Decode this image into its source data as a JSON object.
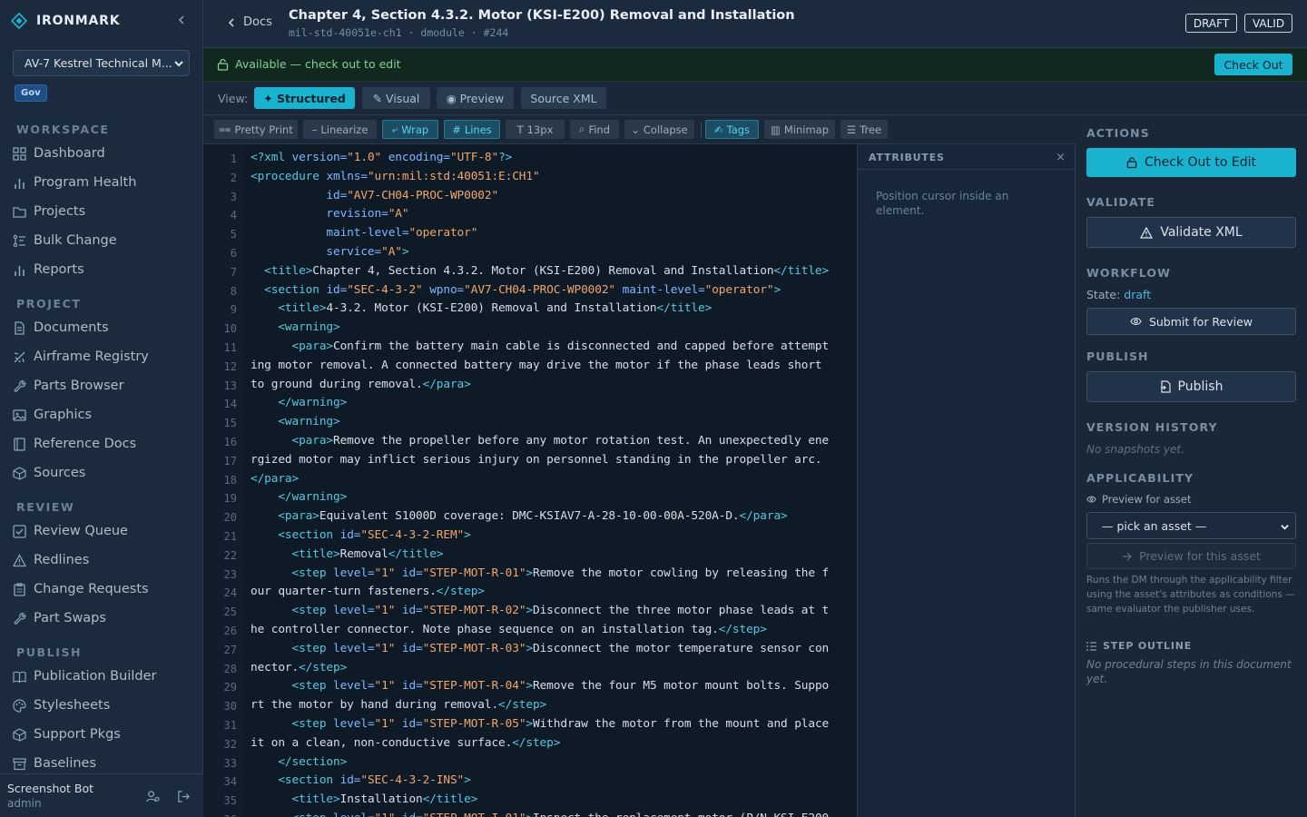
{
  "app": {
    "name": "IRONMARK",
    "manual_select": "AV-7 Kestrel Technical M...",
    "badge": "Gov"
  },
  "sidebar": {
    "sections": [
      {
        "title": "WORKSPACE",
        "items": [
          {
            "label": "Dashboard",
            "icon": "grid-icon"
          },
          {
            "label": "Program Health",
            "icon": "bar-chart-icon"
          },
          {
            "label": "Projects",
            "icon": "folder-icon"
          },
          {
            "label": "Bulk Change",
            "icon": "bulk-change-icon"
          },
          {
            "label": "Reports",
            "icon": "bar-chart-icon"
          }
        ]
      },
      {
        "title": "PROJECT",
        "items": [
          {
            "label": "Documents",
            "icon": "document-icon"
          },
          {
            "label": "Airframe Registry",
            "icon": "plane-icon"
          },
          {
            "label": "Parts Browser",
            "icon": "wrench-icon"
          },
          {
            "label": "Graphics",
            "icon": "image-icon"
          },
          {
            "label": "Reference Docs",
            "icon": "book-icon"
          },
          {
            "label": "Sources",
            "icon": "package-icon"
          }
        ]
      },
      {
        "title": "REVIEW",
        "items": [
          {
            "label": "Review Queue",
            "icon": "checkbox-icon"
          },
          {
            "label": "Redlines",
            "icon": "alert-triangle-icon"
          },
          {
            "label": "Change Requests",
            "icon": "clipboard-icon"
          },
          {
            "label": "Part Swaps",
            "icon": "wrench-icon"
          }
        ]
      },
      {
        "title": "PUBLISH",
        "items": [
          {
            "label": "Publication Builder",
            "icon": "open-book-icon"
          },
          {
            "label": "Stylesheets",
            "icon": "palette-icon"
          },
          {
            "label": "Support Pkgs",
            "icon": "package-icon"
          },
          {
            "label": "Baselines",
            "icon": "archive-icon"
          }
        ]
      }
    ],
    "user": {
      "name": "Screenshot Bot",
      "role": "admin"
    }
  },
  "header": {
    "back": "Docs",
    "title": "Chapter 4, Section 4.3.2. Motor (KSI-E200) Removal and Installation",
    "subtitle": "mil-std-40051e-ch1 · dmodule · #244",
    "badges": [
      "DRAFT",
      "VALID"
    ]
  },
  "status": {
    "text": "Available — check out to edit",
    "button": "Check Out",
    "color": "#7ed39a"
  },
  "viewbar": {
    "label": "View:",
    "modes": [
      {
        "label": "✦ Structured",
        "active": true
      },
      {
        "label": "✎ Visual",
        "active": false
      },
      {
        "label": "◉ Preview",
        "active": false
      },
      {
        "label": "Source XML",
        "active": false
      }
    ]
  },
  "toolbar": {
    "buttons": [
      {
        "label": "Pretty Print",
        "icon": "⩵",
        "on": false
      },
      {
        "label": "Linearize",
        "icon": "–",
        "on": false
      },
      {
        "label": "Wrap",
        "icon": "⤶",
        "on": true
      },
      {
        "label": "Lines",
        "icon": "#",
        "on": true
      },
      {
        "label": "13px",
        "icon": "T",
        "on": false
      },
      {
        "label": "Find",
        "icon": "⌕",
        "on": false
      },
      {
        "label": "Collapse",
        "icon": "⌄",
        "on": false
      },
      {
        "label": "Tags",
        "icon": "✍",
        "on": true
      },
      {
        "label": "Minimap",
        "icon": "▥",
        "on": false
      },
      {
        "label": "Tree",
        "icon": "☰",
        "on": false
      }
    ]
  },
  "editor": {
    "line_numbers": [
      "1",
      "2",
      "3",
      "4",
      "5",
      "6",
      "7",
      "8",
      "9",
      "10",
      "11",
      "12",
      "13",
      "14",
      "15",
      "16",
      "17",
      "18",
      "19",
      "20",
      "21",
      "22",
      "23",
      "24",
      "25",
      "26",
      "27",
      "28",
      "29",
      "30",
      "31",
      "32",
      "33",
      "34",
      "35",
      "36"
    ],
    "lines": [
      [
        [
          "<?xml ",
          "t"
        ],
        [
          "version=",
          "a"
        ],
        [
          "\"1.0\" ",
          "v"
        ],
        [
          "encoding=",
          "a"
        ],
        [
          "\"UTF-8\"",
          "v"
        ],
        [
          "?>",
          "t"
        ]
      ],
      [
        [
          "<procedure ",
          "t"
        ],
        [
          "xmlns=",
          "a"
        ],
        [
          "\"urn:mil:std:40051:E:CH1\"",
          "v"
        ]
      ],
      [
        [
          "           id=",
          "a"
        ],
        [
          "\"AV7-CH04-PROC-WP0002\"",
          "v"
        ]
      ],
      [
        [
          "           revision=",
          "a"
        ],
        [
          "\"A\"",
          "v"
        ]
      ],
      [
        [
          "           maint-level=",
          "a"
        ],
        [
          "\"operator\"",
          "v"
        ]
      ],
      [
        [
          "           service=",
          "a"
        ],
        [
          "\"A\"",
          "v"
        ],
        [
          ">",
          "t"
        ]
      ],
      [
        [
          "  <title>",
          "t"
        ],
        [
          "Chapter 4, Section 4.3.2. Motor (KSI-E200) Removal and Installation",
          "x"
        ],
        [
          "</title>",
          "t"
        ]
      ],
      [
        [
          "  <section ",
          "t"
        ],
        [
          "id=",
          "a"
        ],
        [
          "\"SEC-4-3-2\" ",
          "v"
        ],
        [
          "wpno=",
          "a"
        ],
        [
          "\"AV7-CH04-PROC-WP0002\" ",
          "v"
        ],
        [
          "maint-level=",
          "a"
        ],
        [
          "\"operator\"",
          "v"
        ],
        [
          ">",
          "t"
        ]
      ],
      [
        [
          "    <title>",
          "t"
        ],
        [
          "4-3.2. Motor (KSI-E200) Removal and Installation",
          "x"
        ],
        [
          "</title>",
          "t"
        ]
      ],
      [
        [
          "    <warning>",
          "t"
        ]
      ],
      [
        [
          "      <para>",
          "t"
        ],
        [
          "Confirm the battery main cable is disconnected and capped before attempt",
          "x"
        ]
      ],
      [
        [
          "ing motor removal. A connected battery may drive the motor if the phase leads short",
          "x"
        ]
      ],
      [
        [
          "to ground during removal.",
          "x"
        ],
        [
          "</para>",
          "t"
        ]
      ],
      [
        [
          "    </warning>",
          "t"
        ]
      ],
      [
        [
          "    <warning>",
          "t"
        ]
      ],
      [
        [
          "      <para>",
          "t"
        ],
        [
          "Remove the propeller before any motor rotation test. An unexpectedly ene",
          "x"
        ]
      ],
      [
        [
          "rgized motor may inflict serious injury on personnel standing in the propeller arc.",
          "x"
        ]
      ],
      [
        [
          "</para>",
          "t"
        ]
      ],
      [
        [
          "    </warning>",
          "t"
        ]
      ],
      [
        [
          "    <para>",
          "t"
        ],
        [
          "Equivalent S1000D coverage: DMC-KSIAV7-A-28-10-00-00A-520A-D.",
          "x"
        ],
        [
          "</para>",
          "t"
        ]
      ],
      [
        [
          "    <section ",
          "t"
        ],
        [
          "id=",
          "a"
        ],
        [
          "\"SEC-4-3-2-REM\"",
          "v"
        ],
        [
          ">",
          "t"
        ]
      ],
      [
        [
          "      <title>",
          "t"
        ],
        [
          "Removal",
          "x"
        ],
        [
          "</title>",
          "t"
        ]
      ],
      [
        [
          "      <step ",
          "t"
        ],
        [
          "level=",
          "a"
        ],
        [
          "\"1\" ",
          "v"
        ],
        [
          "id=",
          "a"
        ],
        [
          "\"STEP-MOT-R-01\"",
          "v"
        ],
        [
          ">",
          "t"
        ],
        [
          "Remove the motor cowling by releasing the f",
          "x"
        ]
      ],
      [
        [
          "our quarter-turn fasteners.",
          "x"
        ],
        [
          "</step>",
          "t"
        ]
      ],
      [
        [
          "      <step ",
          "t"
        ],
        [
          "level=",
          "a"
        ],
        [
          "\"1\" ",
          "v"
        ],
        [
          "id=",
          "a"
        ],
        [
          "\"STEP-MOT-R-02\"",
          "v"
        ],
        [
          ">",
          "t"
        ],
        [
          "Disconnect the three motor phase leads at t",
          "x"
        ]
      ],
      [
        [
          "he controller connector. Note phase sequence on an installation tag.",
          "x"
        ],
        [
          "</step>",
          "t"
        ]
      ],
      [
        [
          "      <step ",
          "t"
        ],
        [
          "level=",
          "a"
        ],
        [
          "\"1\" ",
          "v"
        ],
        [
          "id=",
          "a"
        ],
        [
          "\"STEP-MOT-R-03\"",
          "v"
        ],
        [
          ">",
          "t"
        ],
        [
          "Disconnect the motor temperature sensor con",
          "x"
        ]
      ],
      [
        [
          "nector.",
          "x"
        ],
        [
          "</step>",
          "t"
        ]
      ],
      [
        [
          "      <step ",
          "t"
        ],
        [
          "level=",
          "a"
        ],
        [
          "\"1\" ",
          "v"
        ],
        [
          "id=",
          "a"
        ],
        [
          "\"STEP-MOT-R-04\"",
          "v"
        ],
        [
          ">",
          "t"
        ],
        [
          "Remove the four M5 motor mount bolts. Suppo",
          "x"
        ]
      ],
      [
        [
          "rt the motor by hand during removal.",
          "x"
        ],
        [
          "</step>",
          "t"
        ]
      ],
      [
        [
          "      <step ",
          "t"
        ],
        [
          "level=",
          "a"
        ],
        [
          "\"1\" ",
          "v"
        ],
        [
          "id=",
          "a"
        ],
        [
          "\"STEP-MOT-R-05\"",
          "v"
        ],
        [
          ">",
          "t"
        ],
        [
          "Withdraw the motor from the mount and place",
          "x"
        ]
      ],
      [
        [
          "it on a clean, non-conductive surface.",
          "x"
        ],
        [
          "</step>",
          "t"
        ]
      ],
      [
        [
          "    </section>",
          "t"
        ]
      ],
      [
        [
          "    <section ",
          "t"
        ],
        [
          "id=",
          "a"
        ],
        [
          "\"SEC-4-3-2-INS\"",
          "v"
        ],
        [
          ">",
          "t"
        ]
      ],
      [
        [
          "      <title>",
          "t"
        ],
        [
          "Installation",
          "x"
        ],
        [
          "</title>",
          "t"
        ]
      ],
      [
        [
          "      <step ",
          "t"
        ],
        [
          "level=",
          "a"
        ],
        [
          "\"1\" ",
          "v"
        ],
        [
          "id=",
          "a"
        ],
        [
          "\"STEP-MOT-I-01\"",
          "v"
        ],
        [
          ">",
          "t"
        ],
        [
          "Inspect the replacement motor (P/N KSI-E200",
          "x"
        ]
      ]
    ]
  },
  "attributes": {
    "title": "ATTRIBUTES",
    "close": "×",
    "hint": "Position cursor inside an element."
  },
  "actions": {
    "actions_title": "ACTIONS",
    "checkout_label": "Check Out to Edit",
    "validate_title": "VALIDATE",
    "validate_label": "Validate XML",
    "workflow_title": "WORKFLOW",
    "state_label": "State:",
    "state_value": "draft",
    "submit_label": "Submit for Review",
    "publish_title": "PUBLISH",
    "publish_label": "Publish",
    "history_title": "VERSION HISTORY",
    "history_empty": "No snapshots yet.",
    "applicability_title": "APPLICABILITY",
    "asset_label": "Preview for asset",
    "asset_select": "— pick an asset —",
    "preview_label": "Preview for this asset",
    "filter_help": "Runs the DM through the applicability filter using the asset's attributes as conditions — same evaluator the publisher uses.",
    "outline_title": "STEP OUTLINE",
    "outline_empty": "No procedural steps in this document yet."
  }
}
